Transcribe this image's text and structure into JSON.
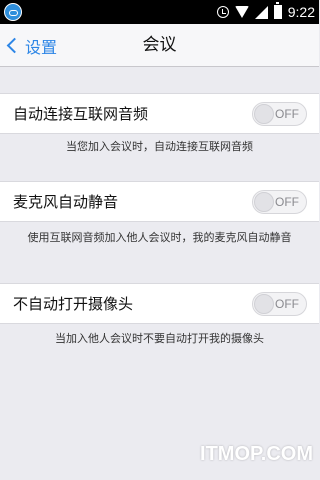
{
  "status_bar": {
    "time": "9:22",
    "icons": [
      "app-icon",
      "alarm-icon",
      "wifi-icon",
      "signal-icon",
      "battery-icon"
    ]
  },
  "nav": {
    "back_label": "设置",
    "title": "会议",
    "accent_color": "#2d86e6"
  },
  "settings": [
    {
      "label": "自动连接互联网音频",
      "toggle": "OFF",
      "hint": "当您加入会议时，自动连接互联网音频"
    },
    {
      "label": "麦克风自动静音",
      "toggle": "OFF",
      "hint": "使用互联网音频加入他人会议时，我的麦克风自动静音"
    },
    {
      "label": "不自动打开摄像头",
      "toggle": "OFF",
      "hint": "当加入他人会议时不要自动打开我的摄像头"
    }
  ],
  "watermark": "ITMOP.COM"
}
